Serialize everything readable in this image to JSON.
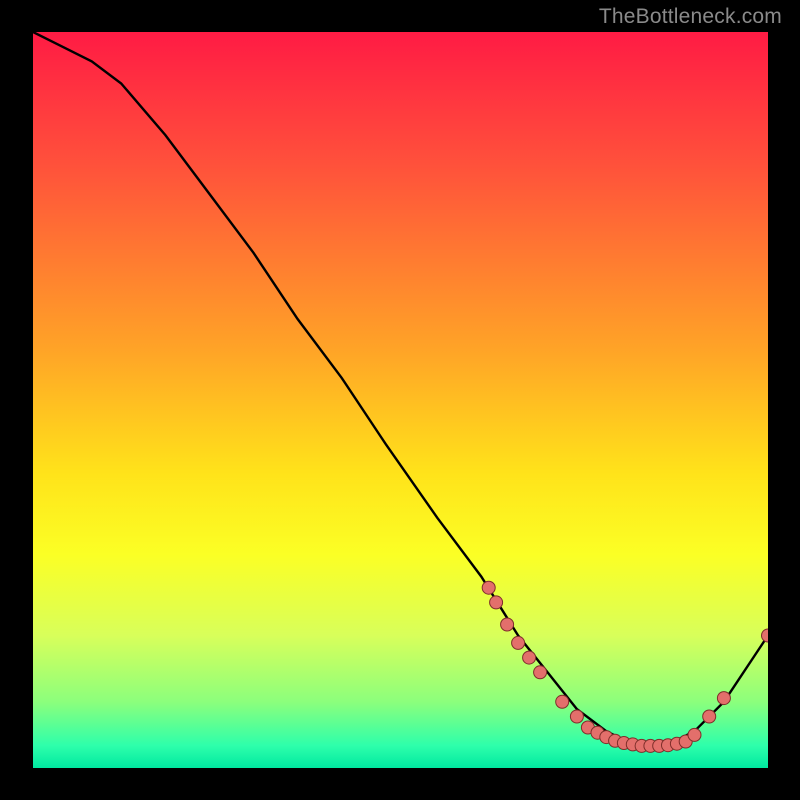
{
  "watermark": "TheBottleneck.com",
  "chart_data": {
    "type": "line",
    "title": "",
    "xlabel": "",
    "ylabel": "",
    "xlim": [
      0,
      100
    ],
    "ylim": [
      0,
      100
    ],
    "grid": false,
    "series": [
      {
        "name": "curve",
        "x": [
          0,
          4,
          8,
          12,
          18,
          24,
          30,
          36,
          42,
          48,
          55,
          61,
          66,
          70,
          74,
          78,
          82,
          86,
          90,
          94,
          100
        ],
        "y": [
          100,
          98,
          96,
          93,
          86,
          78,
          70,
          61,
          53,
          44,
          34,
          26,
          18,
          13,
          8,
          5,
          3,
          3,
          5,
          9,
          18
        ]
      }
    ],
    "data_markers": {
      "name": "dots",
      "x": [
        62,
        63,
        64.5,
        66,
        67.5,
        69,
        72,
        74,
        75.5,
        76.8,
        78,
        79.2,
        80.4,
        81.6,
        82.8,
        84,
        85.2,
        86.4,
        87.6,
        88.8,
        90,
        92,
        94,
        100
      ],
      "y": [
        24.5,
        22.5,
        19.5,
        17,
        15,
        13,
        9,
        7,
        5.5,
        4.8,
        4.2,
        3.7,
        3.4,
        3.2,
        3.0,
        3.0,
        3.0,
        3.1,
        3.3,
        3.6,
        4.5,
        7,
        9.5,
        18
      ]
    },
    "colors": {
      "line": "#000000",
      "marker_fill": "#e36f6b",
      "marker_stroke": "#7e2e2a"
    }
  }
}
